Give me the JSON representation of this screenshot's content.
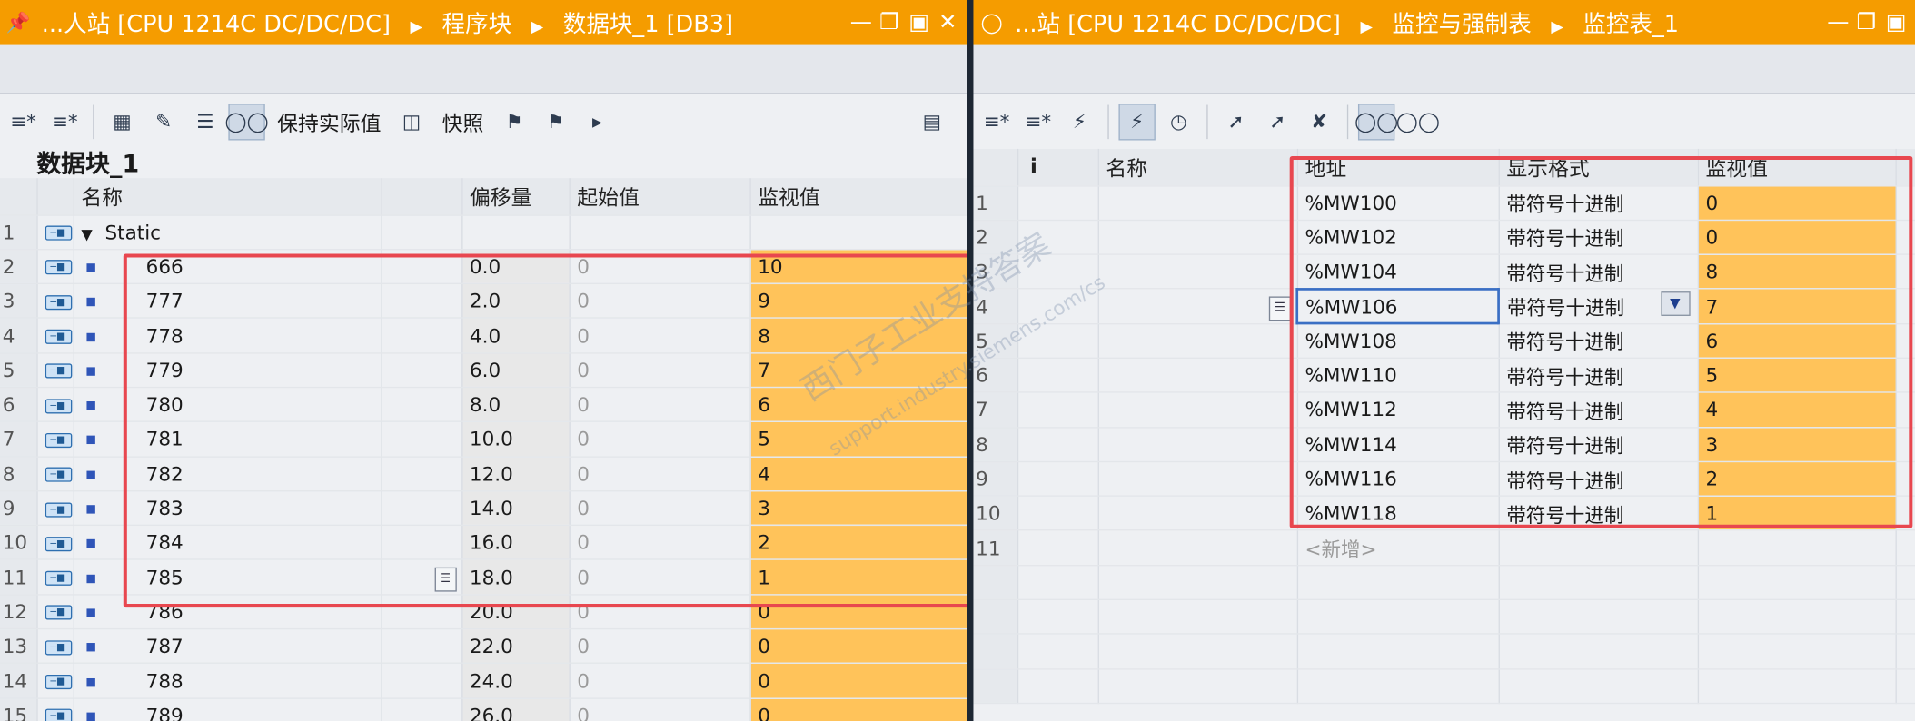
{
  "left": {
    "title": {
      "part1": "...人站 [CPU 1214C DC/DC/DC]",
      "part2": "程序块",
      "part3": "数据块_1 [DB3]"
    },
    "toolbar": {
      "keep_actual": "保持实际值",
      "snapshot": "快照"
    },
    "db_title": "数据块_1",
    "headers": {
      "name": "名称",
      "offset": "偏移量",
      "start": "起始值",
      "monitor": "监视值"
    },
    "static_row": {
      "num": "1",
      "name": "Static"
    },
    "rows": [
      {
        "num": "2",
        "name": "666",
        "offset": "0.0",
        "start": "0",
        "monitor": "10"
      },
      {
        "num": "3",
        "name": "777",
        "offset": "2.0",
        "start": "0",
        "monitor": "9"
      },
      {
        "num": "4",
        "name": "778",
        "offset": "4.0",
        "start": "0",
        "monitor": "8"
      },
      {
        "num": "5",
        "name": "779",
        "offset": "6.0",
        "start": "0",
        "monitor": "7"
      },
      {
        "num": "6",
        "name": "780",
        "offset": "8.0",
        "start": "0",
        "monitor": "6"
      },
      {
        "num": "7",
        "name": "781",
        "offset": "10.0",
        "start": "0",
        "monitor": "5"
      },
      {
        "num": "8",
        "name": "782",
        "offset": "12.0",
        "start": "0",
        "monitor": "4"
      },
      {
        "num": "9",
        "name": "783",
        "offset": "14.0",
        "start": "0",
        "monitor": "3"
      },
      {
        "num": "10",
        "name": "784",
        "offset": "16.0",
        "start": "0",
        "monitor": "2"
      },
      {
        "num": "11",
        "name": "785",
        "offset": "18.0",
        "start": "0",
        "monitor": "1"
      },
      {
        "num": "12",
        "name": "786",
        "offset": "20.0",
        "start": "0",
        "monitor": "0"
      },
      {
        "num": "13",
        "name": "787",
        "offset": "22.0",
        "start": "0",
        "monitor": "0"
      },
      {
        "num": "14",
        "name": "788",
        "offset": "24.0",
        "start": "0",
        "monitor": "0"
      },
      {
        "num": "15",
        "name": "789",
        "offset": "26.0",
        "start": "0",
        "monitor": "0"
      }
    ]
  },
  "right": {
    "title": {
      "part1": "...站 [CPU 1214C DC/DC/DC]",
      "part2": "监控与强制表",
      "part3": "监控表_1"
    },
    "headers": {
      "info": "i",
      "name": "名称",
      "address": "地址",
      "format": "显示格式",
      "monitor": "监视值"
    },
    "rows": [
      {
        "num": "1",
        "address": "%MW100",
        "format": "带符号十进制",
        "monitor": "0"
      },
      {
        "num": "2",
        "address": "%MW102",
        "format": "带符号十进制",
        "monitor": "0"
      },
      {
        "num": "3",
        "address": "%MW104",
        "format": "带符号十进制",
        "monitor": "8"
      },
      {
        "num": "4",
        "address": "%MW106",
        "format": "带符号十进制",
        "monitor": "7"
      },
      {
        "num": "5",
        "address": "%MW108",
        "format": "带符号十进制",
        "monitor": "6"
      },
      {
        "num": "6",
        "address": "%MW110",
        "format": "带符号十进制",
        "monitor": "5"
      },
      {
        "num": "7",
        "address": "%MW112",
        "format": "带符号十进制",
        "monitor": "4"
      },
      {
        "num": "8",
        "address": "%MW114",
        "format": "带符号十进制",
        "monitor": "3"
      },
      {
        "num": "9",
        "address": "%MW116",
        "format": "带符号十进制",
        "monitor": "2"
      },
      {
        "num": "10",
        "address": "%MW118",
        "format": "带符号十进制",
        "monitor": "1"
      }
    ],
    "new_row": {
      "num": "11",
      "label": "<新增>"
    }
  },
  "watermark": {
    "line1": "西门子工业支持答案",
    "line2": "support.industry.siemens.com/cs"
  },
  "colors": {
    "accent": "#f59c00",
    "monitor_fill": "#ffc35a",
    "highlight_box": "#e8474f"
  }
}
